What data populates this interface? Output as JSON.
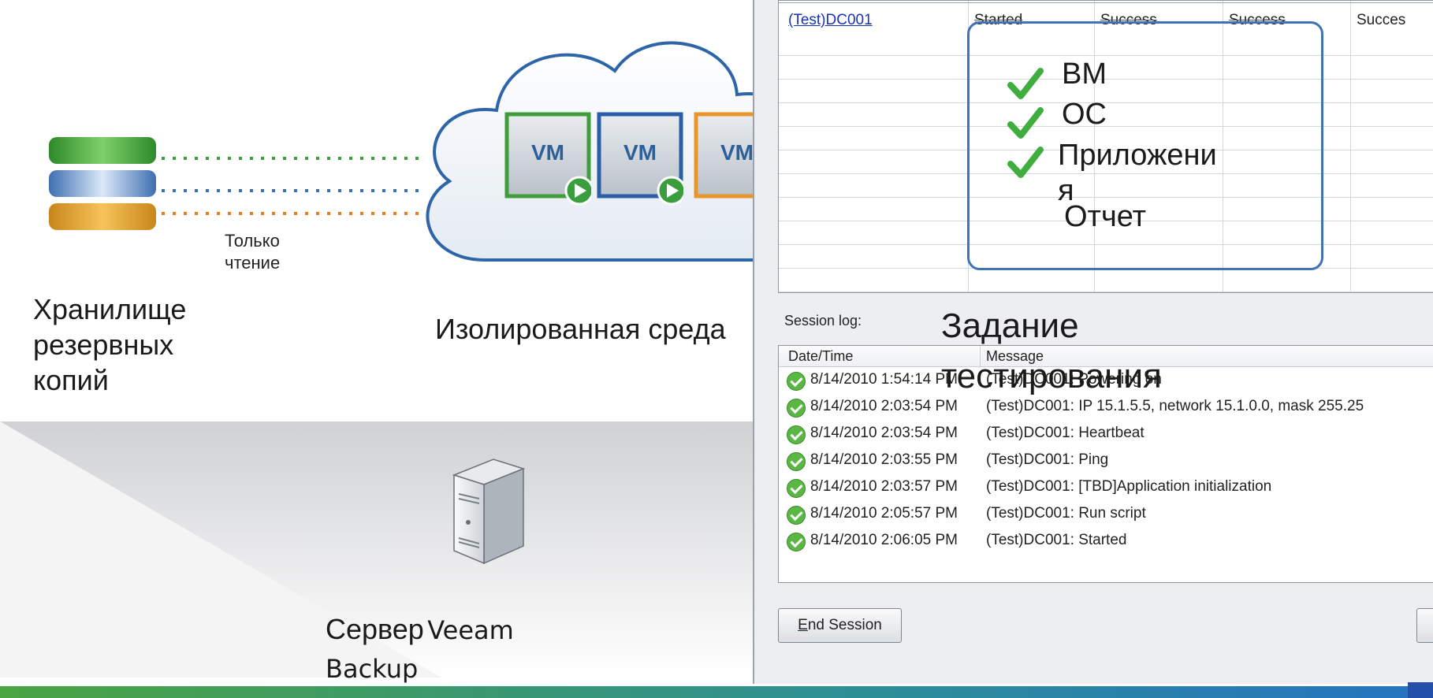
{
  "storage": {
    "title_line1": "Хранилище",
    "title_line2": "резервных",
    "title_line3": "копий",
    "readonly_line1": "Только",
    "readonly_line2": "чтение"
  },
  "lab": {
    "title": "Изолированная среда",
    "vms": [
      {
        "label": "VM",
        "color": "#3f9e3a"
      },
      {
        "label": "VM",
        "color": "#2a5ea8"
      },
      {
        "label": "VM",
        "color": "#e8962a"
      }
    ]
  },
  "server": {
    "title_word": "Сервер",
    "title_rest1": "Veeam",
    "title_rest2": "Backup"
  },
  "job": {
    "title_line1": "Задание",
    "title_line2": "тестирования"
  },
  "overlay": {
    "items": [
      "ВМ",
      "ОС",
      "Приложени",
      "я"
    ],
    "report": "Отчет",
    "border_color": "#3e73b7",
    "check_color": "#3fae3f"
  },
  "window": {
    "grid_row": {
      "vm_name": "(Test)DC001",
      "status": "Started",
      "col3": "Success",
      "col4": "Success",
      "col5": "Succes"
    },
    "session_log_label": "Session log:",
    "log_headers": {
      "date": "Date/Time",
      "message": "Message"
    },
    "log_rows": [
      {
        "date": "8/14/2010 1:54:14 PM",
        "message": "(Test)DC001: Powering on"
      },
      {
        "date": "8/14/2010 2:03:54 PM",
        "message": "(Test)DC001: IP 15.1.5.5, network 15.1.0.0, mask 255.25"
      },
      {
        "date": "8/14/2010 2:03:54 PM",
        "message": "(Test)DC001: Heartbeat"
      },
      {
        "date": "8/14/2010 2:03:55 PM",
        "message": "(Test)DC001: Ping"
      },
      {
        "date": "8/14/2010 2:03:57 PM",
        "message": "(Test)DC001: [TBD]Application initialization"
      },
      {
        "date": "8/14/2010 2:05:57 PM",
        "message": "(Test)DC001: Run script"
      },
      {
        "date": "8/14/2010 2:06:05 PM",
        "message": "(Test)DC001: Started"
      }
    ],
    "end_session_label": "End Session",
    "end_session_mnemonic": "E",
    "end_session_rest": "nd Session"
  }
}
